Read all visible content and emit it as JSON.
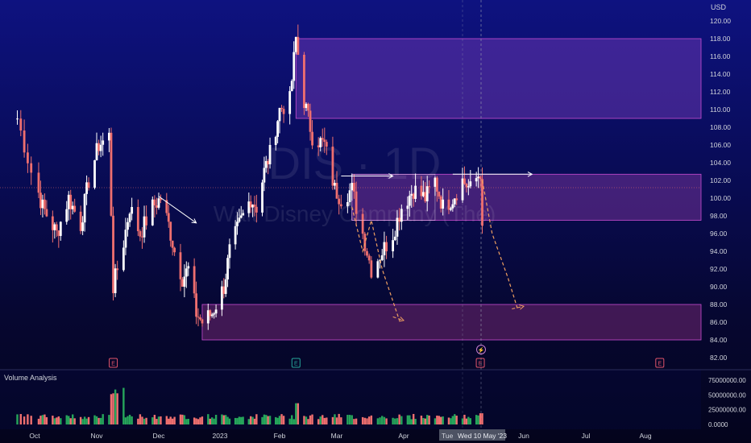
{
  "chart_data": {
    "type": "candlestick",
    "symbol": "DIS",
    "interval": "1D",
    "company": "Walt Disney Company (The)",
    "currency": "USD",
    "ylim": [
      82,
      120
    ],
    "y_ticks": [
      "120.00",
      "118.00",
      "116.00",
      "114.00",
      "112.00",
      "110.00",
      "108.00",
      "106.00",
      "104.00",
      "102.00",
      "100.00",
      "98.00",
      "96.00",
      "94.00",
      "92.00",
      "90.00",
      "88.00",
      "86.00",
      "84.00",
      "82.00"
    ],
    "x_ticks": [
      "Oct",
      "Nov",
      "Dec",
      "2023",
      "Feb",
      "Mar",
      "Apr",
      "May",
      "Jun",
      "Jul",
      "Aug"
    ],
    "crosshair_label": "Wed 10 May '23",
    "hidden_label": "Tue",
    "volume_panel": {
      "title": "Volume Analysis",
      "ticks": [
        "75000000.00",
        "50000000.00",
        "25000000.00",
        "0.0000"
      ]
    },
    "close_path": [
      [
        "2022-09-26",
        109
      ],
      [
        "2022-09-30",
        103
      ],
      [
        "2022-10-05",
        99
      ],
      [
        "2022-10-12",
        96
      ],
      [
        "2022-10-18",
        100
      ],
      [
        "2022-10-24",
        97
      ],
      [
        "2022-10-28",
        102
      ],
      [
        "2022-11-02",
        106
      ],
      [
        "2022-11-07",
        107
      ],
      [
        "2022-11-09",
        90
      ],
      [
        "2022-11-14",
        95
      ],
      [
        "2022-11-17",
        99
      ],
      [
        "2022-11-22",
        96
      ],
      [
        "2022-11-28",
        99
      ],
      [
        "2022-12-02",
        100
      ],
      [
        "2022-12-06",
        97
      ],
      [
        "2022-12-09",
        94
      ],
      [
        "2022-12-13",
        91
      ],
      [
        "2022-12-16",
        92
      ],
      [
        "2022-12-20",
        87
      ],
      [
        "2022-12-23",
        86
      ],
      [
        "2022-12-28",
        87
      ],
      [
        "2023-01-03",
        90
      ],
      [
        "2023-01-06",
        94
      ],
      [
        "2023-01-11",
        97
      ],
      [
        "2023-01-17",
        100
      ],
      [
        "2023-01-20",
        99
      ],
      [
        "2023-01-24",
        103
      ],
      [
        "2023-01-27",
        105
      ],
      [
        "2023-02-01",
        110
      ],
      [
        "2023-02-06",
        111
      ],
      [
        "2023-02-09",
        118
      ],
      [
        "2023-02-13",
        111
      ],
      [
        "2023-02-17",
        107
      ],
      [
        "2023-02-23",
        106
      ],
      [
        "2023-02-28",
        101
      ],
      [
        "2023-03-03",
        100
      ],
      [
        "2023-03-08",
        101
      ],
      [
        "2023-03-13",
        96
      ],
      [
        "2023-03-17",
        92
      ],
      [
        "2023-03-22",
        94
      ],
      [
        "2023-03-27",
        96
      ],
      [
        "2023-03-31",
        99
      ],
      [
        "2023-04-06",
        101
      ],
      [
        "2023-04-12",
        100
      ],
      [
        "2023-04-17",
        102
      ],
      [
        "2023-04-21",
        99
      ],
      [
        "2023-04-26",
        100
      ],
      [
        "2023-05-01",
        102
      ],
      [
        "2023-05-05",
        101
      ],
      [
        "2023-05-10",
        103
      ],
      [
        "2023-05-11",
        96
      ]
    ],
    "zones": [
      {
        "from": "2023-02-09",
        "to": "end",
        "low": 109,
        "high": 118,
        "color": "#7b3fbf",
        "opacity": 0.45
      },
      {
        "from": "2023-03-08",
        "to": "end",
        "low": 97.5,
        "high": 102.7,
        "color": "#8a3aa8",
        "opacity": 0.45
      },
      {
        "from": "2022-12-23",
        "to": "end",
        "low": 84,
        "high": 88,
        "color": "#7a2a78",
        "opacity": 0.5
      }
    ],
    "events": [
      {
        "date": "2022-11-09",
        "label": "E",
        "color": "#e0546b"
      },
      {
        "date": "2023-02-09",
        "label": "E",
        "color": "#26a69a"
      },
      {
        "date": "2023-05-10",
        "label": "E",
        "color": "#e0546b"
      },
      {
        "date": "2023-08-09",
        "label": "E",
        "color": "#e0546b"
      }
    ],
    "colors": {
      "up": "#ffffff",
      "down": "#ef6f6f",
      "vol_up": "#26a65b",
      "vol_down": "#ef6f6f",
      "zone_border": "#c74bd0",
      "projection": "#f0a060"
    }
  }
}
